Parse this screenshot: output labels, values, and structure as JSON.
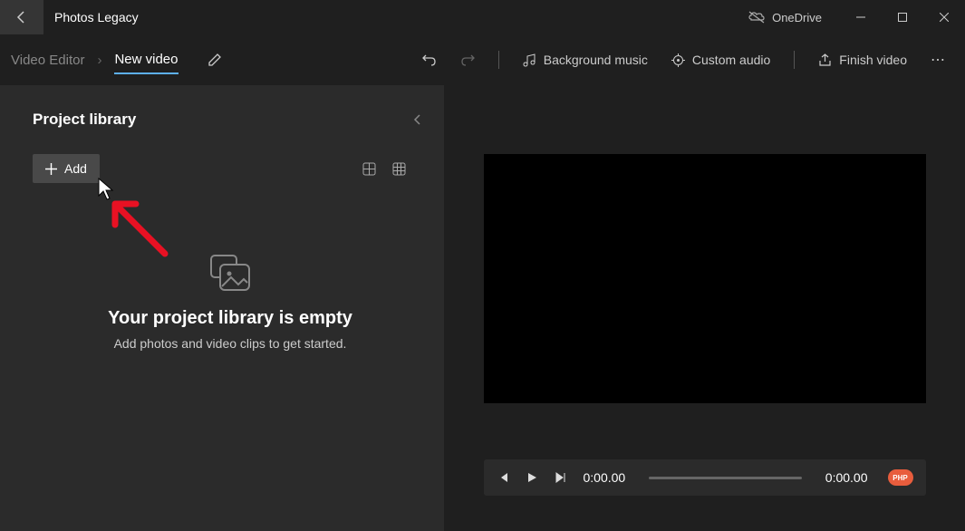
{
  "titlebar": {
    "app_title": "Photos Legacy",
    "onedrive_label": "OneDrive"
  },
  "toolbar": {
    "breadcrumb_root": "Video Editor",
    "breadcrumb_current": "New video",
    "bg_music_label": "Background music",
    "custom_audio_label": "Custom audio",
    "finish_label": "Finish video"
  },
  "library": {
    "title": "Project library",
    "add_label": "Add",
    "empty_title": "Your project library is empty",
    "empty_subtitle": "Add photos and video clips to get started."
  },
  "player": {
    "time_current": "0:00.00",
    "time_total": "0:00.00"
  },
  "watermark": "PHP"
}
